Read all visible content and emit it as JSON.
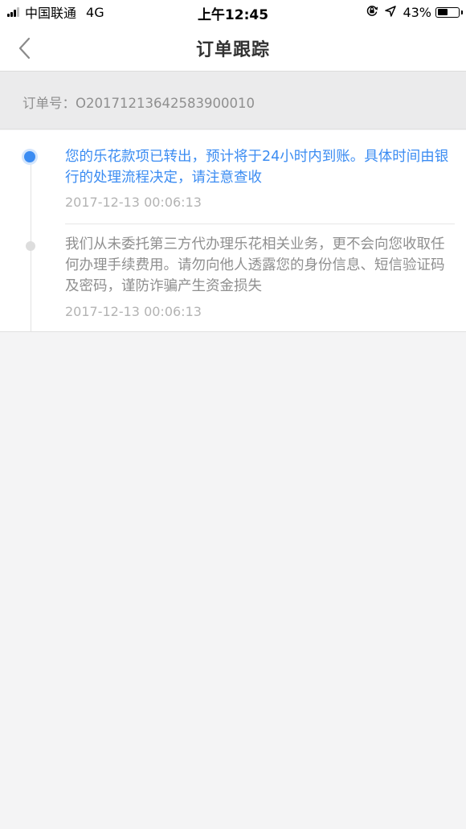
{
  "status_bar": {
    "carrier": "中国联通",
    "network": "4G",
    "time": "上午12:45",
    "battery_text": "43%",
    "battery_level": 0.43,
    "icons": [
      "signal-icon",
      "orientation-lock-icon",
      "location-arrow-icon",
      "battery-icon"
    ]
  },
  "nav": {
    "title": "订单跟踪",
    "back_icon": "chevron-left-icon"
  },
  "order": {
    "text": "订单号：O20171213642583900010"
  },
  "timeline": [
    {
      "message": "您的乐花款项已转出，预计将于24小时内到账。具体时间由银行的处理流程决定，请注意查收",
      "time": "2017-12-13 00:06:13",
      "active": true
    },
    {
      "message": "我们从未委托第三方代办理乐花相关业务，更不会向您收取任何办理手续费用。请勿向他人透露您的身份信息、短信验证码及密码，谨防诈骗产生资金损失",
      "time": "2017-12-13 00:06:13",
      "active": false
    }
  ],
  "colors": {
    "accent": "#3b8cf2",
    "page_background": "#f4f4f5",
    "order_background": "#ebebec",
    "muted_text": "#8f8f8f",
    "time_text": "#b3b3b3"
  }
}
